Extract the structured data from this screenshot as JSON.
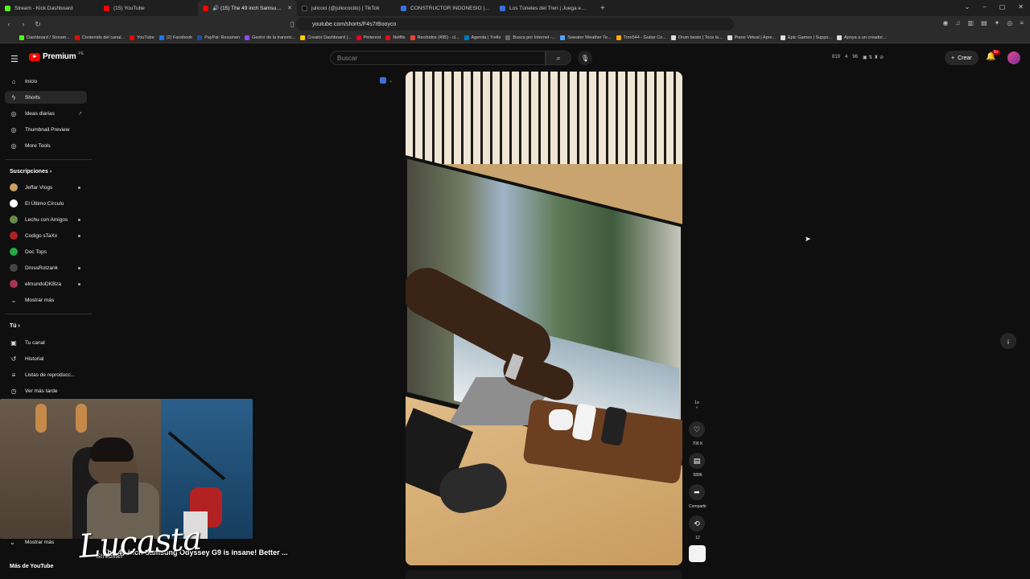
{
  "browser": {
    "tabs": [
      {
        "label": "Stream - Kick Dashboard",
        "color": "#53fc18"
      },
      {
        "label": "(15) YouTube",
        "color": "#ff0000"
      },
      {
        "label": "🔊 (15) The 49 inch Samsung O...",
        "color": "#ff0000"
      },
      {
        "label": "julicoci (@juliococito) | TikTok",
        "color": "#111111"
      },
      {
        "label": "CONSTRUCTOR INDONESIO | Juega ...",
        "color": "#3b6fe0"
      },
      {
        "label": "Los Túneles del Tren | Juega en Robl...",
        "color": "#3b6fe0"
      }
    ],
    "url": "youtube.com/shorts/F4s7rBooyco",
    "bookmarks": [
      {
        "label": "Dashboard / Stream...",
        "color": "#53fc18"
      },
      {
        "label": "Contenido del canal...",
        "color": "#ff0000"
      },
      {
        "label": "YouTube",
        "color": "#ff0000"
      },
      {
        "label": "(2) Facebook",
        "color": "#1877f2"
      },
      {
        "label": "PayPal: Resumen",
        "color": "#1a4e9e"
      },
      {
        "label": "Gestor de la transmi...",
        "color": "#9146ff"
      },
      {
        "label": "Creator Dashboard |...",
        "color": "#ffcc00"
      },
      {
        "label": "Pinterest",
        "color": "#e60023"
      },
      {
        "label": "Netflix",
        "color": "#e50914"
      },
      {
        "label": "Recibidos (495) - cl...",
        "color": "#ea4335"
      },
      {
        "label": "Agenda | Trello",
        "color": "#0079bf"
      },
      {
        "label": "Busca por Internet -...",
        "color": "#666666"
      },
      {
        "label": "Sweater Weather Te...",
        "color": "#4da3ff"
      },
      {
        "label": "Tron544 - Guitar Co...",
        "color": "#ffaa00"
      },
      {
        "label": "Drum beats | Toca la...",
        "color": "#dddddd"
      },
      {
        "label": "Piano Virtual | Apre...",
        "color": "#dddddd"
      },
      {
        "label": "Epic Games | Suppo...",
        "color": "#dddddd"
      },
      {
        "label": "Apoya a un creador...",
        "color": "#dddddd"
      }
    ]
  },
  "youtube": {
    "brand": "Premium",
    "brand_sup": "PE",
    "search_placeholder": "Buscar",
    "stats": {
      "a": "819",
      "b": "4",
      "c": "96"
    },
    "create_label": "Crear",
    "notif_badge": "9+",
    "sidebar": {
      "main": [
        {
          "label": "Inicio",
          "icon": "home-icon"
        },
        {
          "label": "Shorts",
          "icon": "shorts-icon"
        },
        {
          "label": "Ideas diarias",
          "icon": "bulb-icon"
        },
        {
          "label": "Thumbnail Preview",
          "icon": "image-icon"
        },
        {
          "label": "More Tools",
          "icon": "tools-icon"
        }
      ],
      "subs_title": "Suscripciones",
      "subs": [
        {
          "label": "Jeffar Vlogs",
          "color": "#c8a060"
        },
        {
          "label": "El Último Círculo",
          "color": "#ffffff"
        },
        {
          "label": "Lechu con Amigos",
          "color": "#6a8a4a"
        },
        {
          "label": "Codigo sTaXx",
          "color": "#b22222"
        },
        {
          "label": "Doc Tops",
          "color": "#22aa44"
        },
        {
          "label": "DrossRotzank",
          "color": "#444444"
        },
        {
          "label": "elmundoDKBza",
          "color": "#aa3355"
        }
      ],
      "show_more": "Mostrar más",
      "you_title": "Tú",
      "you": [
        {
          "label": "Tu canal",
          "icon": "channel-icon"
        },
        {
          "label": "Historial",
          "icon": "history-icon"
        },
        {
          "label": "Listas de reproducc...",
          "icon": "playlist-icon"
        },
        {
          "label": "Ver más tarde",
          "icon": "clock-icon"
        }
      ],
      "show_more_2": "Mostrar más",
      "more_yt": "Más de YouTube"
    },
    "short": {
      "title": "The 49 inch Samsung Odyssey G9 is insane! Better ...",
      "speed": "1x",
      "likes": "706 K",
      "comments": "5896",
      "share": "Compartir",
      "remix": "12"
    },
    "stream_watermark": "Lucasta",
    "stream_watermark_sub": "Streamer"
  }
}
